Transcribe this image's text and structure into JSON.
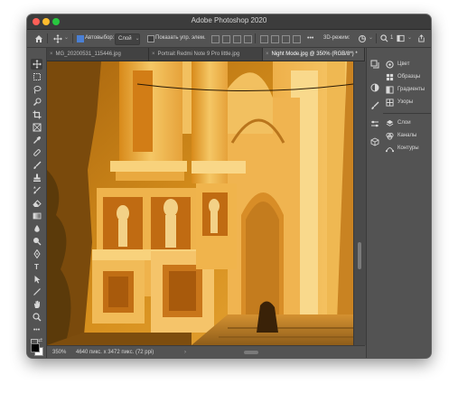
{
  "window": {
    "title": "Adobe Photoshop 2020"
  },
  "options_bar": {
    "autoselect_label": "Автовыбор:",
    "layer_dropdown": "Слой",
    "show_transform_label": "Показать упр. элем.",
    "more_label": "•••",
    "mode_3d_label": "3D-режим:",
    "zoom_indicator": "1"
  },
  "tabs": [
    {
      "label": "MG_20200531_115446.jpg"
    },
    {
      "label": "Portrait Redmi Note 9 Pro little.jpg"
    },
    {
      "label": "Night Mode.jpg @ 350% (RGB/8*) *",
      "active": true
    }
  ],
  "status": {
    "zoom": "350%",
    "doc_info": "4640 пикс. x 3472 пикс. (72 ppi)"
  },
  "panels": {
    "items": [
      {
        "label": "Цвет",
        "icon": "color-wheel-icon"
      },
      {
        "label": "Образцы",
        "icon": "swatches-icon"
      },
      {
        "label": "Градиенты",
        "icon": "gradient-icon"
      },
      {
        "label": "Узоры",
        "icon": "patterns-icon"
      },
      {
        "label": "Слои",
        "icon": "layers-icon"
      },
      {
        "label": "Каналы",
        "icon": "channels-icon"
      },
      {
        "label": "Контуры",
        "icon": "paths-icon"
      }
    ]
  },
  "tools": [
    "move-tool-icon",
    "marquee-tool-icon",
    "lasso-tool-icon",
    "quick-select-tool-icon",
    "crop-tool-icon",
    "frame-tool-icon",
    "eyedropper-tool-icon",
    "healing-brush-icon",
    "brush-tool-icon",
    "clone-stamp-icon",
    "history-brush-icon",
    "eraser-tool-icon",
    "gradient-tool-icon",
    "blur-tool-icon",
    "dodge-tool-icon",
    "pen-tool-icon",
    "type-tool-icon",
    "path-select-icon",
    "line-tool-icon",
    "hand-tool-icon",
    "zoom-tool-icon",
    "more-tools-icon"
  ],
  "colors": {
    "ui_dark": "#535353",
    "canvas_orange": "#d8901e",
    "accent_blue": "#4a7fd4"
  }
}
